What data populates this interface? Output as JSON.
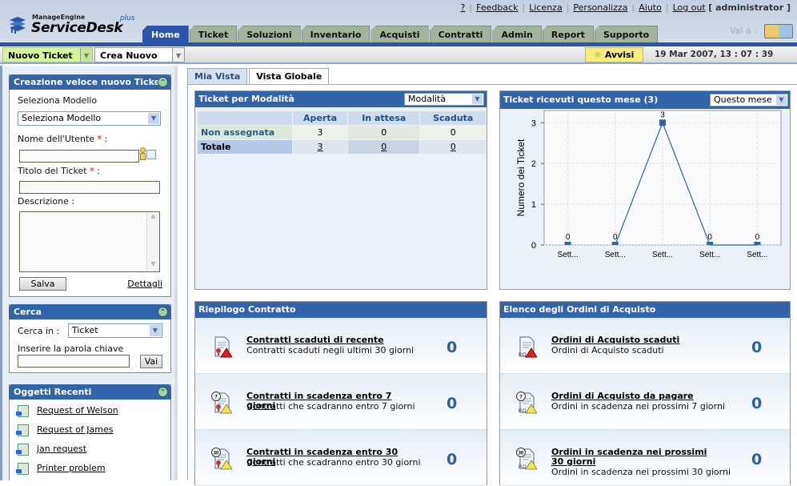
{
  "header": {
    "brand_top": "ManageEngine",
    "brand_main": "ServiceDesk",
    "brand_plus": "plus",
    "links": [
      {
        "label": "?"
      },
      {
        "label": "Feedback"
      },
      {
        "label": "Licenza"
      },
      {
        "label": "Personalizza"
      },
      {
        "label": "Aiuto"
      },
      {
        "label": "Log out"
      }
    ],
    "user": "[ administrator ]",
    "goto_label": "Vai a :",
    "tabs": [
      {
        "label": "Home",
        "active": true
      },
      {
        "label": "Ticket"
      },
      {
        "label": "Soluzioni"
      },
      {
        "label": "Inventario"
      },
      {
        "label": "Acquisti"
      },
      {
        "label": "Contratti"
      },
      {
        "label": "Admin"
      },
      {
        "label": "Report"
      },
      {
        "label": "Supporto"
      }
    ]
  },
  "toolbar": {
    "new_ticket": "Nuovo Ticket",
    "create_new": "Crea Nuovo",
    "alerts": "Avvisi",
    "datetime": "19 Mar 2007, 13 : 07 : 39"
  },
  "quick_ticket": {
    "title": "Creazione veloce nuovo Ticket",
    "template_label": "Seleziona Modello",
    "template_value": "Seleziona Modello",
    "user_label": "Nome dell'Utente",
    "title_label": "Titolo del Ticket",
    "required_mark": "*",
    "colon": ":",
    "desc_label": "Descrizione :",
    "user_value": "",
    "title_value": "",
    "desc_value": "",
    "save": "Salva",
    "details": "Dettagli"
  },
  "search": {
    "title": "Cerca",
    "search_in_label": "Cerca in :",
    "search_in_value": "Ticket",
    "keyword_label": "Inserire la parola chiave",
    "keyword_value": "",
    "go": "Vai"
  },
  "recent": {
    "title": "Oggetti Recenti",
    "items": [
      {
        "label": "Request of Welson"
      },
      {
        "label": "Request of James"
      },
      {
        "label": "jan request"
      },
      {
        "label": "Printer problem"
      }
    ]
  },
  "view_tabs": [
    {
      "label": "Mia Vista"
    },
    {
      "label": "Vista Globale",
      "active": true
    }
  ],
  "by_mode": {
    "title": "Ticket per Modalità",
    "filter": "Modalità",
    "columns": [
      "",
      "Aperta",
      "In attesa",
      "Scaduta"
    ],
    "rows": [
      {
        "label": "Non assegnata",
        "values": [
          "3",
          "0",
          "0"
        ]
      },
      {
        "label": "Totale",
        "values": [
          "3",
          "0",
          "0"
        ]
      }
    ]
  },
  "received": {
    "title": "Ticket ricevuti questo mese (3)",
    "filter": "Questo mese"
  },
  "chart_data": {
    "type": "line",
    "title": "Ticket ricevuti questo mese (3)",
    "xlabel": "",
    "ylabel": "Numero dei Ticket",
    "categories": [
      "Sett...",
      "Sett...",
      "Sett...",
      "Sett...",
      "Sett..."
    ],
    "values": [
      0,
      0,
      3,
      0,
      0
    ],
    "data_labels": [
      "0",
      "0",
      "3",
      "0",
      "0"
    ],
    "ylim": [
      0,
      3.3
    ],
    "yticks": [
      "0",
      "1",
      "2",
      "3"
    ],
    "grid": true,
    "series_color": "#3164a8"
  },
  "contracts": {
    "title": "Riepilogo Contratto",
    "rows": [
      {
        "title": "Contratti scaduti di recente",
        "desc": "Contratti scaduti negli ultimi 30 giorni",
        "count": "0",
        "badge": ""
      },
      {
        "title": "Contratti in scadenza entro 7 giorni",
        "desc": "Contratti che scadranno entro 7 giorni",
        "count": "0",
        "badge": "7"
      },
      {
        "title": "Contratti in scadenza entro 30 giorni",
        "desc": "Contratti che scadranno entro 30 giorni",
        "count": "0",
        "badge": "30"
      }
    ]
  },
  "purchase_orders": {
    "title": "Elenco degli Ordini di Acquisto",
    "rows": [
      {
        "title": "Ordini di Acquisto scaduti",
        "desc": "Ordini di Acquisto scaduti",
        "count": "0",
        "badge": ""
      },
      {
        "title": "Ordini di Acquisto da pagare",
        "desc": "Ordini in scadenza nei prossimi 7 giorni",
        "count": "0",
        "badge": "7"
      },
      {
        "title": "Ordini in scadenza nei prossimi 30 giorni",
        "desc": "Ordini in scadenza nei prossimi 30 giorni",
        "count": "0",
        "badge": "30"
      }
    ],
    "po_tag": "P.O"
  },
  "colors": {
    "brand_blue": "#2a55a8",
    "panel_header": "#3164a8",
    "tab_inactive": "#a3b49c",
    "new_ticket_bg": "#d4f59a",
    "alerts_bg": "#f8ec7c"
  }
}
